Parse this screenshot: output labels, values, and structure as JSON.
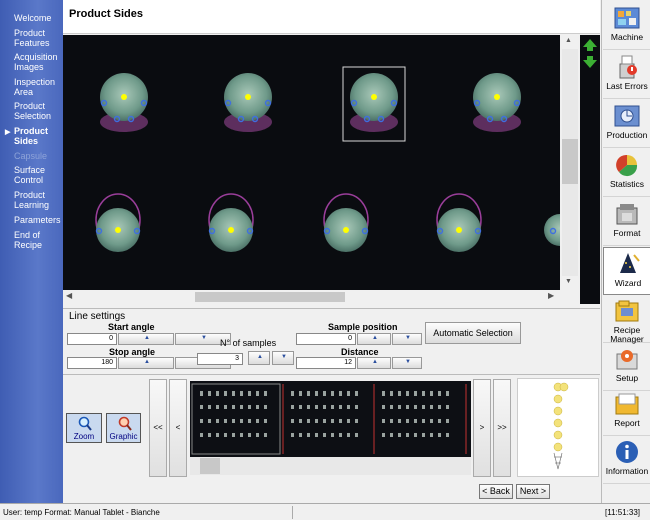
{
  "sidebar": {
    "items": [
      {
        "label": "Welcome",
        "state": "normal"
      },
      {
        "label": "Product Features",
        "state": "normal"
      },
      {
        "label": "Acquisition Images",
        "state": "normal"
      },
      {
        "label": "Inspection Area",
        "state": "normal"
      },
      {
        "label": "Product Selection",
        "state": "normal"
      },
      {
        "label": "Product Sides",
        "state": "active"
      },
      {
        "label": "Capsule",
        "state": "disabled"
      },
      {
        "label": "Surface Control",
        "state": "normal"
      },
      {
        "label": "Product Learning",
        "state": "normal"
      },
      {
        "label": "Parameters",
        "state": "normal"
      },
      {
        "label": "End of Recipe",
        "state": "normal"
      }
    ],
    "bullet": "▶"
  },
  "header": {
    "title": "Product Sides"
  },
  "line_settings": {
    "title": "Line settings",
    "start_angle_label": "Start angle",
    "start_angle_value": "0",
    "stop_angle_label": "Stop angle",
    "stop_angle_value": "180",
    "samples_label": "N° of samples",
    "samples_value": "3",
    "sample_position_label": "Sample position",
    "sample_position_value": "0",
    "distance_label": "Distance",
    "distance_value": "12",
    "auto_button": "Automatic Selection"
  },
  "strip": {
    "zoom_label": "Zoom",
    "graphic_label": "Graphic",
    "first_label": "<<",
    "prev_label": "<",
    "next_label": ">",
    "last_label": ">>"
  },
  "navigation": {
    "back_label": "< Back",
    "next_label": "Next >"
  },
  "toolbar": {
    "items": [
      {
        "label": "Machine",
        "icon": "machine-icon"
      },
      {
        "label": "Last Errors",
        "icon": "errors-icon"
      },
      {
        "label": "Production",
        "icon": "production-icon"
      },
      {
        "label": "Statistics",
        "icon": "statistics-icon"
      },
      {
        "label": "Format",
        "icon": "format-icon"
      },
      {
        "label": "Wizard",
        "icon": "wizard-icon",
        "active": true
      },
      {
        "label": "Recipe Manager",
        "icon": "recipe-icon"
      },
      {
        "label": "Setup",
        "icon": "setup-icon"
      },
      {
        "label": "Report",
        "icon": "report-icon"
      },
      {
        "label": "Information",
        "icon": "info-icon"
      }
    ]
  },
  "status": {
    "left": "User: temp   Format: Manual Tablet - Bianche",
    "time": "[11:51:33]"
  },
  "colors": {
    "sidebar": "#4a68bd",
    "accent": "#2b4f9e",
    "tablet": "#6fa09a"
  }
}
